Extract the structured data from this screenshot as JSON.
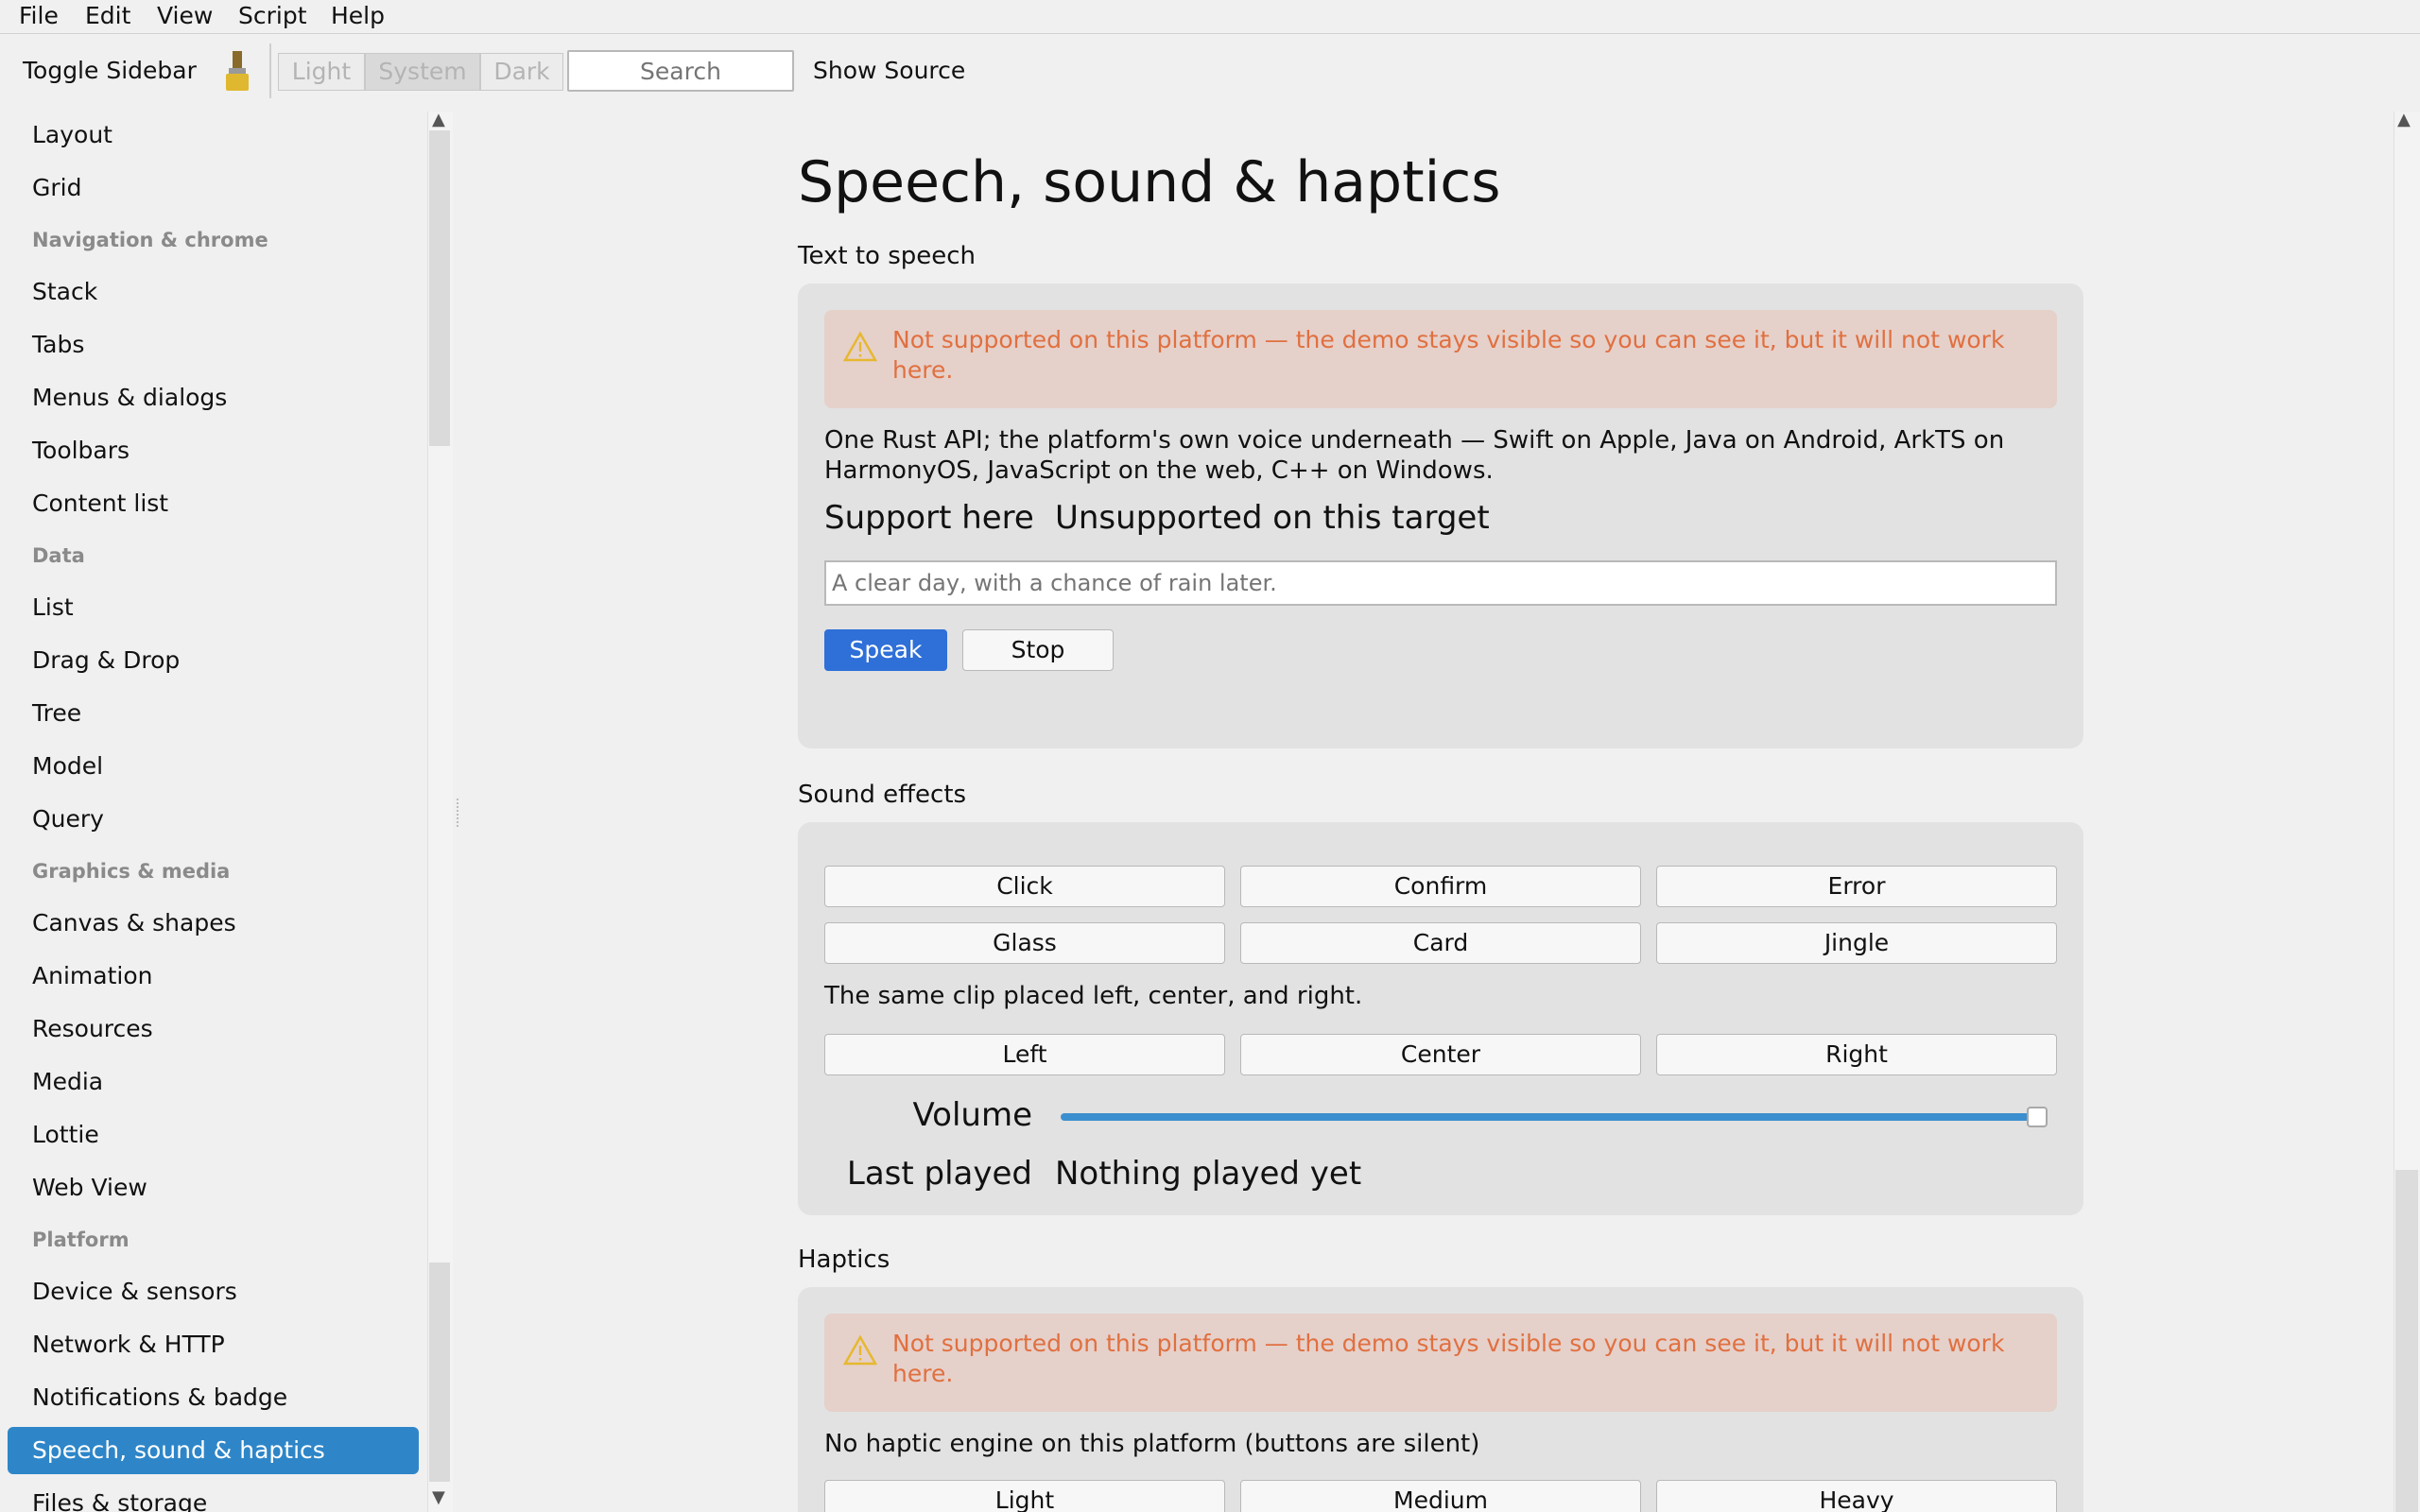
{
  "menu": [
    "File",
    "Edit",
    "View",
    "Script",
    "Help"
  ],
  "toolbar": {
    "toggle_sidebar": "Toggle Sidebar",
    "themes": [
      "Light",
      "System",
      "Dark"
    ],
    "selected_theme": "System",
    "search_placeholder": "Search",
    "show_source": "Show Source"
  },
  "sidebar": {
    "items": [
      {
        "label": "Layout"
      },
      {
        "label": "Grid"
      },
      {
        "label": "Navigation & chrome",
        "header": true
      },
      {
        "label": "Stack"
      },
      {
        "label": "Tabs"
      },
      {
        "label": "Menus & dialogs"
      },
      {
        "label": "Toolbars"
      },
      {
        "label": "Content list"
      },
      {
        "label": "Data",
        "header": true
      },
      {
        "label": "List"
      },
      {
        "label": "Drag & Drop"
      },
      {
        "label": "Tree"
      },
      {
        "label": "Model"
      },
      {
        "label": "Query"
      },
      {
        "label": "Graphics & media",
        "header": true
      },
      {
        "label": "Canvas & shapes"
      },
      {
        "label": "Animation"
      },
      {
        "label": "Resources"
      },
      {
        "label": "Media"
      },
      {
        "label": "Lottie"
      },
      {
        "label": "Web View"
      },
      {
        "label": "Platform",
        "header": true
      },
      {
        "label": "Device & sensors"
      },
      {
        "label": "Network & HTTP"
      },
      {
        "label": "Notifications & badge"
      },
      {
        "label": "Speech, sound & haptics",
        "active": true
      },
      {
        "label": "Files & storage"
      }
    ]
  },
  "page": {
    "title": "Speech, sound & haptics",
    "tts": {
      "section": "Text to speech",
      "warning": "Not supported on this platform — the demo stays visible so you can see it, but it will not work here.",
      "description": "One Rust API; the platform's own voice underneath — Swift on Apple, Java on Android, ArkTS on HarmonyOS, JavaScript on the web, C++ on Windows.",
      "support_label": "Support here",
      "support_value": "Unsupported on this target",
      "input_placeholder": "A clear day, with a chance of rain later.",
      "speak": "Speak",
      "stop": "Stop"
    },
    "sfx": {
      "section": "Sound effects",
      "clips": [
        "Click",
        "Confirm",
        "Error",
        "Glass",
        "Card",
        "Jingle"
      ],
      "pan_note": "The same clip placed left, center, and right.",
      "pans": [
        "Left",
        "Center",
        "Right"
      ],
      "volume_label": "Volume",
      "volume": 1.0,
      "last_label": "Last played",
      "last_value": "Nothing played yet"
    },
    "haptics": {
      "section": "Haptics",
      "warning": "Not supported on this platform — the demo stays visible so you can see it, but it will not work here.",
      "note": "No haptic engine on this platform (buttons are silent)",
      "buttons": [
        "Light",
        "Medium",
        "Heavy"
      ]
    }
  },
  "colors": {
    "accent": "#2e86c8",
    "primary_button": "#2e6fd8",
    "warning_text": "#e07040",
    "warning_bg": "#e6d0ca"
  }
}
